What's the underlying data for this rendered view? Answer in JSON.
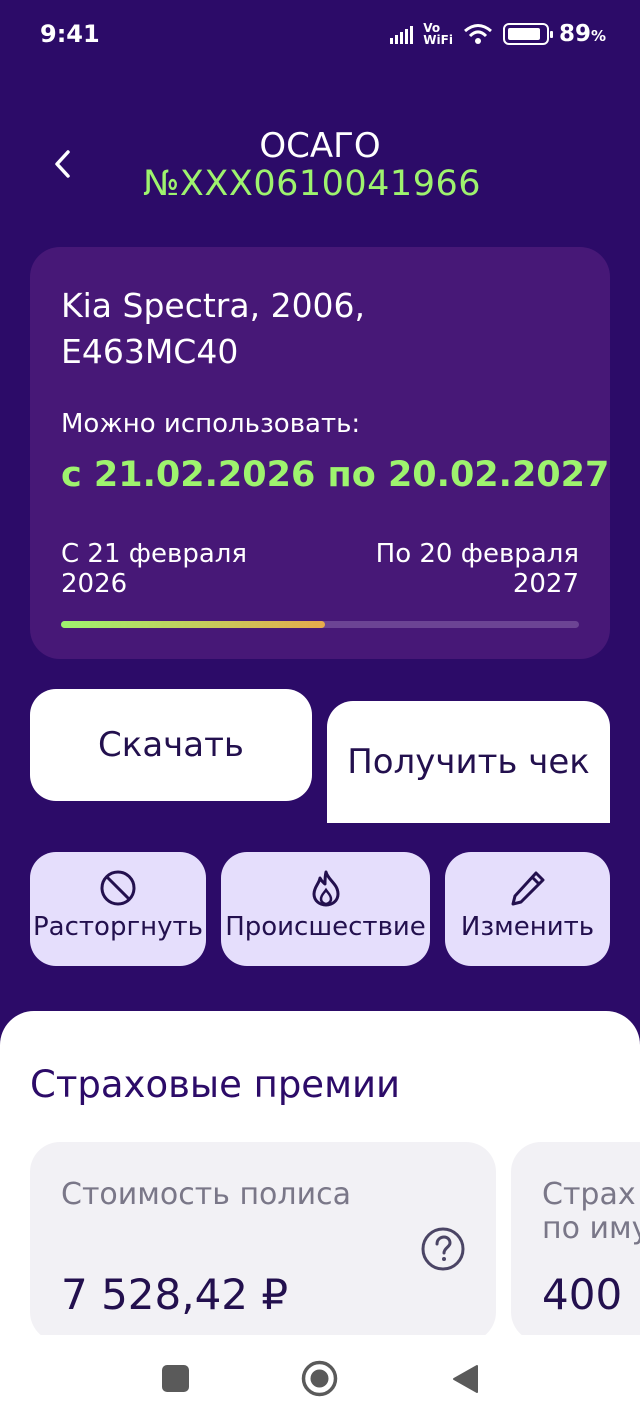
{
  "status_bar": {
    "time": "9:41",
    "network_top": "Vo",
    "network_bottom": "WiFi",
    "battery_level": 89,
    "battery_text": "89",
    "battery_unit": "%"
  },
  "header": {
    "title": "ОСАГО",
    "policy_number": "№XXX0610041966"
  },
  "policy": {
    "car": "Kia Spectra, 2006, Е463МС40",
    "validity_label": "Можно использовать:",
    "validity_range": "с 21.02.2026 по 20.02.2027",
    "from_label": "С 21 февраля 2026",
    "to_label": "По 20 февраля 2027",
    "progress": 0.51
  },
  "actions": {
    "download": "Скачать",
    "receipt": "Получить чек",
    "terminate": "Расторгнуть",
    "incident": "Происшествие",
    "edit": "Изменить"
  },
  "premiums": {
    "title": "Страховые премии",
    "cards": [
      {
        "label": "Стоимость полиса",
        "value": "7 528,42 ₽"
      },
      {
        "label": "Страх по иму",
        "value": "400"
      }
    ]
  },
  "colors": {
    "background": "#2c0b68",
    "card": "#471877",
    "accent_green": "#9ef36e",
    "action_button": "#e5defc"
  },
  "icons": {
    "back": "chevron-left-icon",
    "terminate": "ban-icon",
    "incident": "fire-icon",
    "edit": "pencil-icon",
    "help": "question-circle-icon"
  }
}
